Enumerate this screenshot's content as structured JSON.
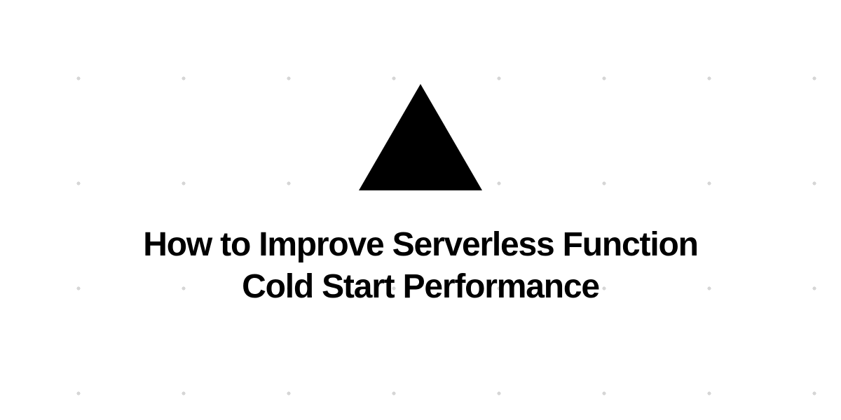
{
  "hero": {
    "title": "How to Improve Serverless Function Cold Start Performance"
  }
}
